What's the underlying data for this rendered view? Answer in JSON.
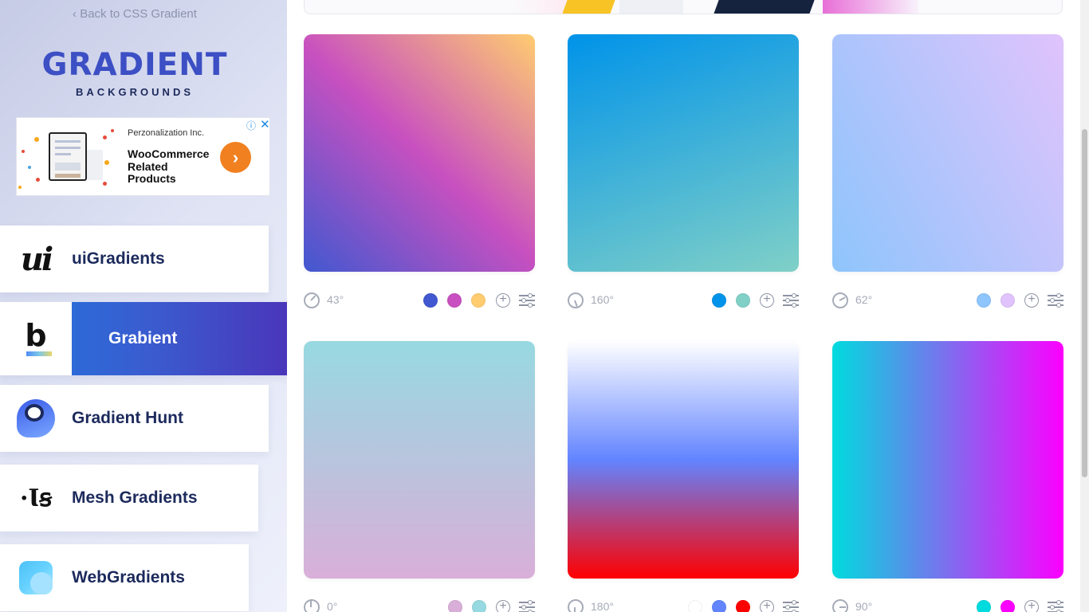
{
  "sidebar": {
    "back_link": "‹ Back to CSS Gradient",
    "logo_word": "Gradient",
    "logo_sub": "BACKGROUNDS",
    "ad": {
      "company": "Perzonalization Inc.",
      "title": "WooCommerce Related Products",
      "cta_icon": "chevron-right-icon",
      "cta_glyph": "›",
      "info_glyph": "ⓘ",
      "close_glyph": "✕"
    },
    "nav": [
      {
        "label": "uiGradients",
        "icon": "ui-logo-icon",
        "glyph": "ui",
        "active": false
      },
      {
        "label": "Grabient",
        "icon": "grabient-logo-icon",
        "glyph": "b",
        "active": true
      },
      {
        "label": "Gradient Hunt",
        "icon": "gradient-hunt-logo-icon",
        "active": false
      },
      {
        "label": "Mesh Gradients",
        "icon": "mesh-gradients-logo-icon",
        "glyph": "·Ꙇꞩ",
        "active": false
      },
      {
        "label": "WebGradients",
        "icon": "webgradients-logo-icon",
        "active": false
      }
    ]
  },
  "gradients": [
    {
      "angle": "43°",
      "colors": [
        "#4158D0",
        "#C850C0",
        "#FFCC70"
      ]
    },
    {
      "angle": "160°",
      "colors": [
        "#0093E9",
        "#80D0C7"
      ]
    },
    {
      "angle": "62°",
      "colors": [
        "#8EC5FC",
        "#E0C3FC"
      ]
    },
    {
      "angle": "0°",
      "colors": [
        "#D9AFD9",
        "#97D9E1"
      ]
    },
    {
      "angle": "180°",
      "colors": [
        "#FFFFFF",
        "#6284FF",
        "#FF0000"
      ]
    },
    {
      "angle": "90°",
      "colors": [
        "#00DBDE",
        "#FC00FF"
      ]
    }
  ],
  "card_actions": {
    "add_icon": "plus-circle-icon",
    "add_glyph": "+",
    "settings_icon": "sliders-icon"
  },
  "theme": {
    "active_gradient_start": "#2176E0",
    "active_gradient_end": "#4B33B8",
    "nav_text": "#1C2A5C",
    "muted_text": "#A6ABB8"
  }
}
